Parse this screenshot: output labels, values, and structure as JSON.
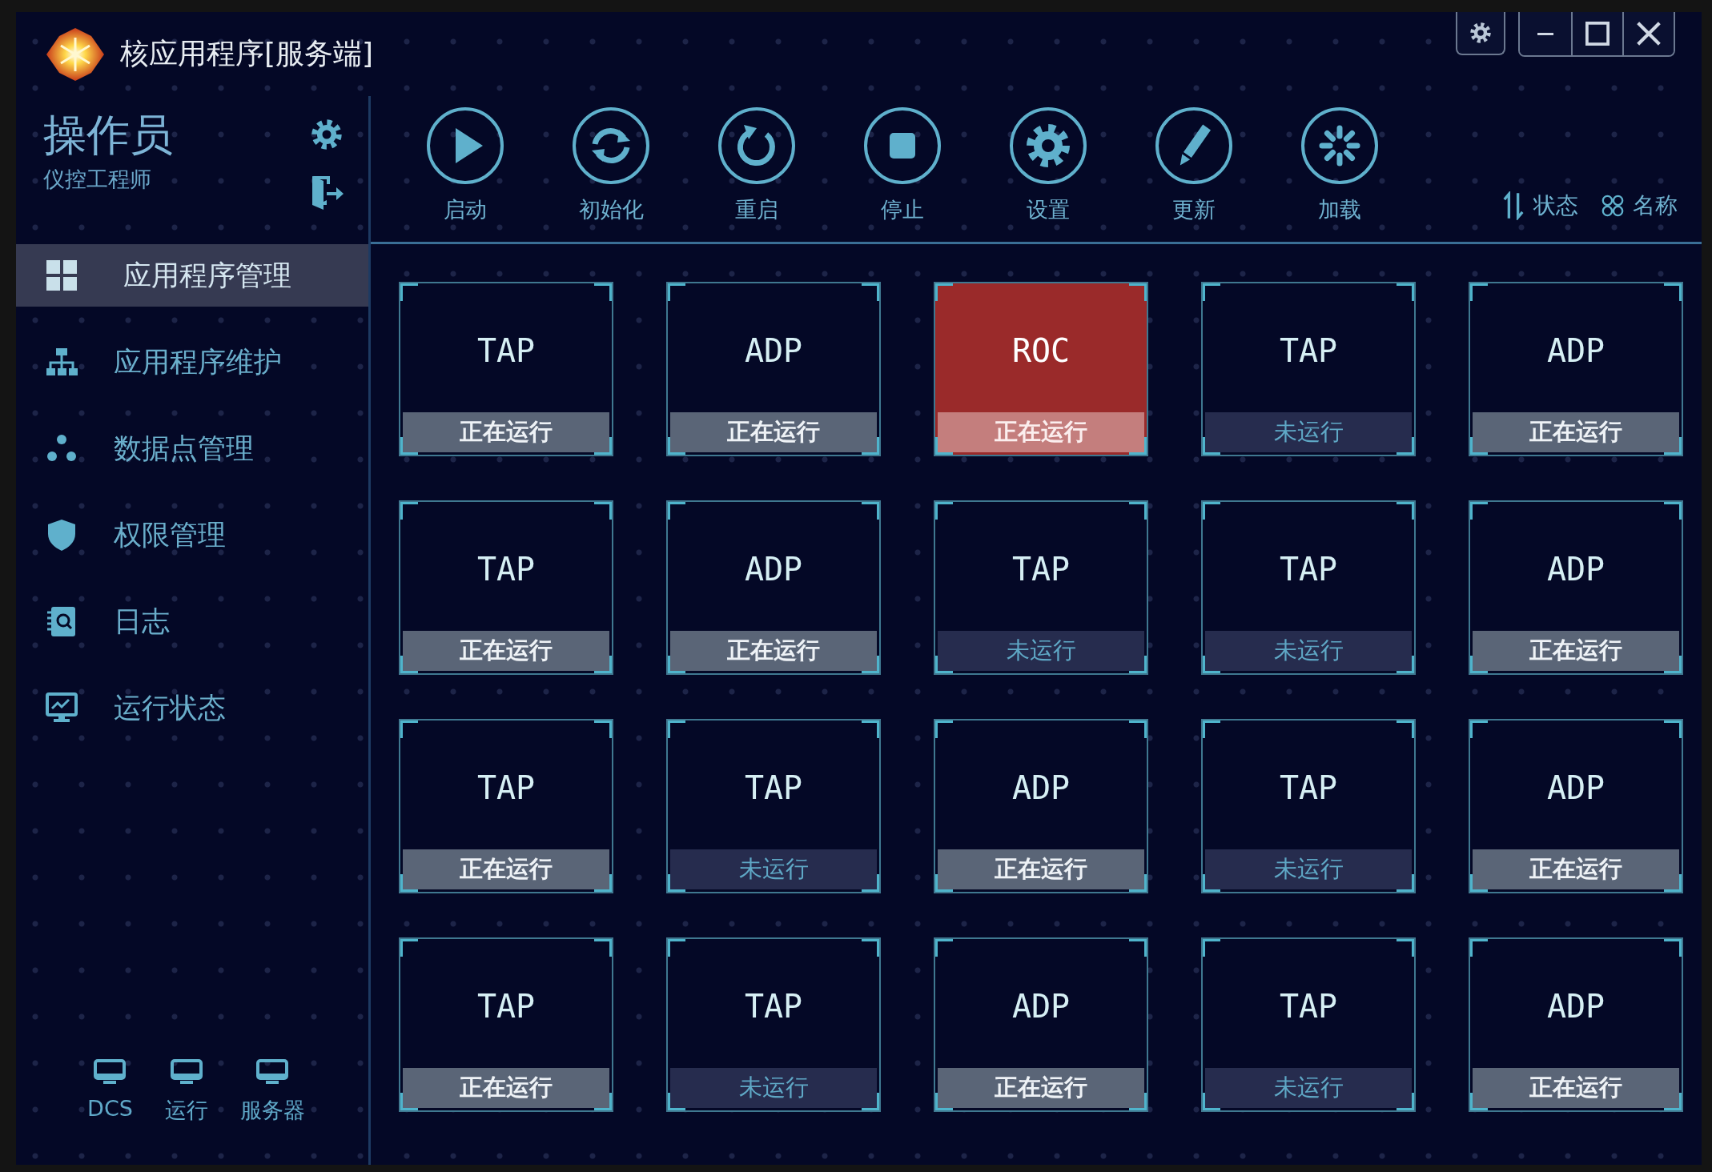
{
  "window": {
    "title": "核应用程序[服务端]"
  },
  "user": {
    "name": "操作员",
    "role": "仪控工程师"
  },
  "nav": [
    {
      "label": "应用程序管理",
      "selected": true
    },
    {
      "label": "应用程序维护",
      "selected": false
    },
    {
      "label": "数据点管理",
      "selected": false
    },
    {
      "label": "权限管理",
      "selected": false
    },
    {
      "label": "日志",
      "selected": false
    },
    {
      "label": "运行状态",
      "selected": false
    }
  ],
  "nodes": [
    {
      "label": "DCS"
    },
    {
      "label": "运行"
    },
    {
      "label": "服务器"
    }
  ],
  "toolbar": [
    {
      "label": "启动"
    },
    {
      "label": "初始化"
    },
    {
      "label": "重启"
    },
    {
      "label": "停止"
    },
    {
      "label": "设置"
    },
    {
      "label": "更新"
    },
    {
      "label": "加载"
    }
  ],
  "sort": [
    {
      "label": "状态"
    },
    {
      "label": "名称"
    }
  ],
  "apps": [
    {
      "name": "TAP",
      "status": "正在运行",
      "running": true,
      "alarm": false
    },
    {
      "name": "ADP",
      "status": "正在运行",
      "running": true,
      "alarm": false
    },
    {
      "name": "ROC",
      "status": "正在运行",
      "running": true,
      "alarm": true
    },
    {
      "name": "TAP",
      "status": "未运行",
      "running": false,
      "alarm": false
    },
    {
      "name": "ADP",
      "status": "正在运行",
      "running": true,
      "alarm": false
    },
    {
      "name": "TAP",
      "status": "正在运行",
      "running": true,
      "alarm": false
    },
    {
      "name": "ADP",
      "status": "正在运行",
      "running": true,
      "alarm": false
    },
    {
      "name": "TAP",
      "status": "未运行",
      "running": false,
      "alarm": false
    },
    {
      "name": "TAP",
      "status": "未运行",
      "running": false,
      "alarm": false
    },
    {
      "name": "ADP",
      "status": "正在运行",
      "running": true,
      "alarm": false
    },
    {
      "name": "TAP",
      "status": "正在运行",
      "running": true,
      "alarm": false
    },
    {
      "name": "TAP",
      "status": "未运行",
      "running": false,
      "alarm": false
    },
    {
      "name": "ADP",
      "status": "正在运行",
      "running": true,
      "alarm": false
    },
    {
      "name": "TAP",
      "status": "未运行",
      "running": false,
      "alarm": false
    },
    {
      "name": "ADP",
      "status": "正在运行",
      "running": true,
      "alarm": false
    },
    {
      "name": "TAP",
      "status": "正在运行",
      "running": true,
      "alarm": false
    },
    {
      "name": "TAP",
      "status": "未运行",
      "running": false,
      "alarm": false
    },
    {
      "name": "ADP",
      "status": "正在运行",
      "running": true,
      "alarm": false
    },
    {
      "name": "TAP",
      "status": "未运行",
      "running": false,
      "alarm": false
    },
    {
      "name": "ADP",
      "status": "正在运行",
      "running": true,
      "alarm": false
    }
  ]
}
